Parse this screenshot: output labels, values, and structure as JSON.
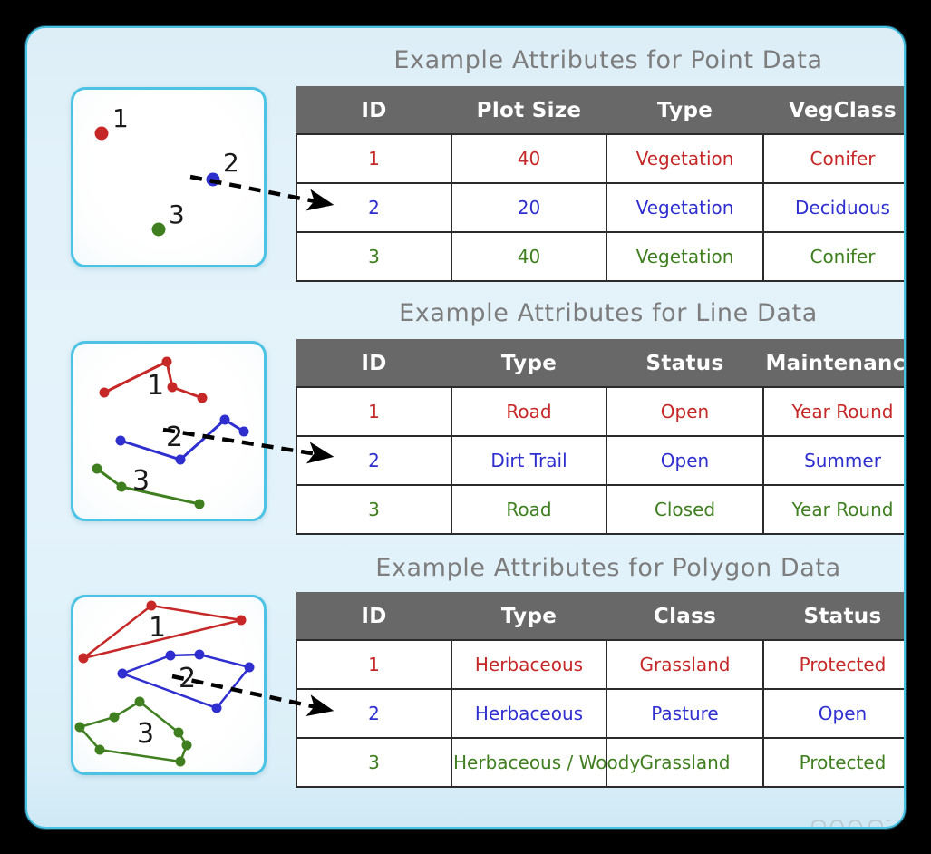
{
  "sections": [
    {
      "title": "Example Attributes for Point Data",
      "geometry_type": "point",
      "columns": [
        "ID",
        "Plot Size",
        "Type",
        "VegClass"
      ],
      "rows": [
        {
          "id": "1",
          "b": "40",
          "c": "Vegetation",
          "d": "Conifer",
          "color": "#c62828"
        },
        {
          "id": "2",
          "b": "20",
          "c": "Vegetation",
          "d": "Deciduous",
          "color": "#2f2fd0"
        },
        {
          "id": "3",
          "b": "40",
          "c": "Vegetation",
          "d": "Conifer",
          "color": "#3f7f1f"
        }
      ],
      "map_labels": [
        "1",
        "2",
        "3"
      ]
    },
    {
      "title": "Example Attributes for Line Data",
      "geometry_type": "line",
      "columns": [
        "ID",
        "Type",
        "Status",
        "Maintenance"
      ],
      "rows": [
        {
          "id": "1",
          "b": "Road",
          "c": "Open",
          "d": "Year Round",
          "color": "#c62828"
        },
        {
          "id": "2",
          "b": "Dirt Trail",
          "c": "Open",
          "d": "Summer",
          "color": "#2f2fd0"
        },
        {
          "id": "3",
          "b": "Road",
          "c": "Closed",
          "d": "Year Round",
          "color": "#3f7f1f"
        }
      ],
      "map_labels": [
        "1",
        "2",
        "3"
      ]
    },
    {
      "title": "Example Attributes for Polygon Data",
      "geometry_type": "polygon",
      "columns": [
        "ID",
        "Type",
        "Class",
        "Status"
      ],
      "rows": [
        {
          "id": "1",
          "b": "Herbaceous",
          "c": "Grassland",
          "d": "Protected",
          "color": "#c62828"
        },
        {
          "id": "2",
          "b": "Herbaceous",
          "c": "Pasture",
          "d": "Open",
          "color": "#2f2fd0"
        },
        {
          "id": "3",
          "b": "Herbaceous / Woody",
          "c": "Grassland",
          "d": "Protected",
          "color": "#3f7f1f"
        }
      ],
      "map_labels": [
        "1",
        "2",
        "3"
      ]
    }
  ],
  "colors": {
    "feature_red": "#c62828",
    "feature_blue": "#2f2fd0",
    "feature_green": "#3f7f1f",
    "header_gray": "#686868",
    "title_gray": "#7d7d7d",
    "panel_border_cyan": "#4cc3e4",
    "card_background": "#e3f2fa",
    "page_background": "#000000"
  },
  "logo": {
    "name": "neon",
    "text": "neon"
  }
}
